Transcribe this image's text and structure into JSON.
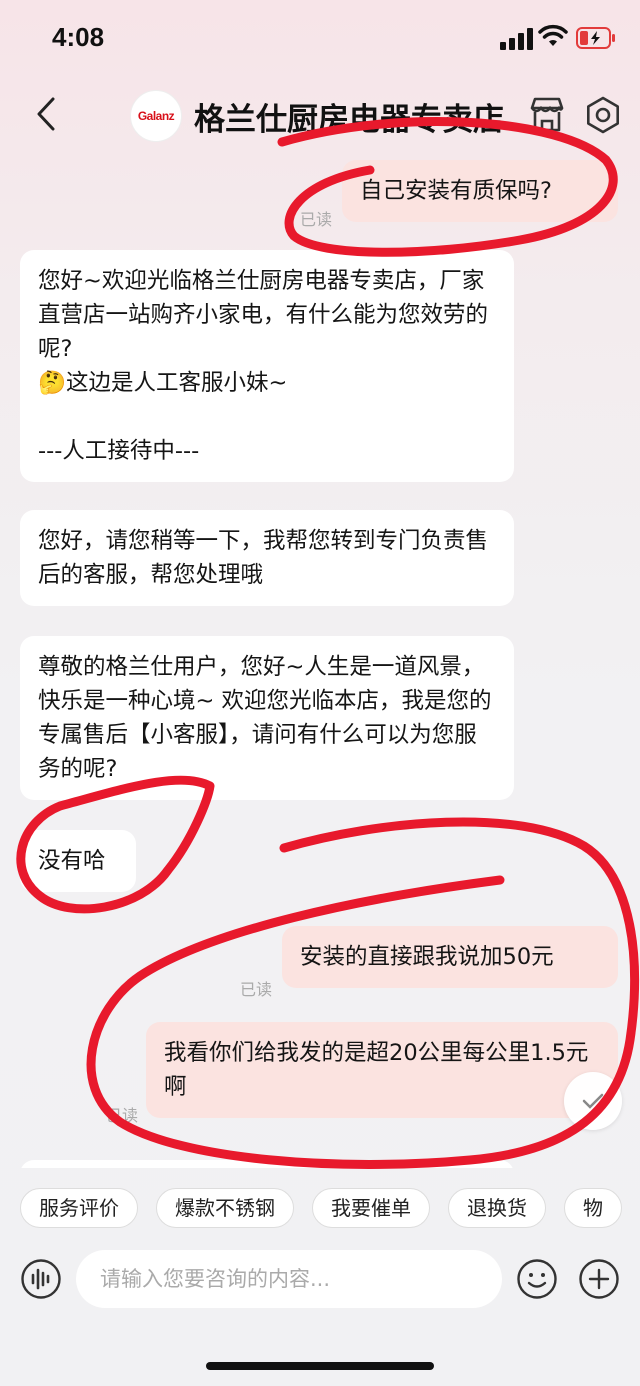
{
  "status_bar": {
    "time": "4:08"
  },
  "nav": {
    "logo_text": "Galanz",
    "shop_name": "格兰仕厨房电器专卖店"
  },
  "messages": [
    {
      "side": "right",
      "text": "自己安装有质保吗?",
      "read": "已读"
    },
    {
      "side": "left",
      "text": "您好~欢迎光临格兰仕厨房电器专卖店，厂家直营店一站购齐小家电，有什么能为您效劳的呢?\n🤔这边是人工客服小妹~\n\n---人工接待中---"
    },
    {
      "side": "left",
      "text": "您好，请您稍等一下，我帮您转到专门负责售后的客服，帮您处理哦"
    },
    {
      "side": "left",
      "text": "尊敬的格兰仕用户，您好~人生是一道风景，快乐是一种心境~ 欢迎您光临本店，我是您的专属售后【小客服】，请问有什么可以为您服务的呢?"
    },
    {
      "side": "left",
      "text": "没有哈"
    },
    {
      "side": "right",
      "text": "安装的直接跟我说加50元",
      "read": "已读"
    },
    {
      "side": "right",
      "text": "我看你们给我发的是超20公里每公里1.5元啊",
      "read": "已读"
    }
  ],
  "quick_replies": [
    "服务评价",
    "爆款不锈钢",
    "我要催单",
    "退换货",
    "物"
  ],
  "input": {
    "placeholder": "请输入您要咨询的内容..."
  },
  "colors": {
    "right_bubble": "#fbe3e0",
    "left_bubble": "#ffffff",
    "annotation": "#e8192c",
    "brand": "#d8101a"
  },
  "icons": {
    "back": "chevron-left-icon",
    "store": "store-icon",
    "settings": "settings-icon",
    "voice": "voice-icon",
    "emoji": "emoji-icon",
    "plus": "plus-icon"
  }
}
